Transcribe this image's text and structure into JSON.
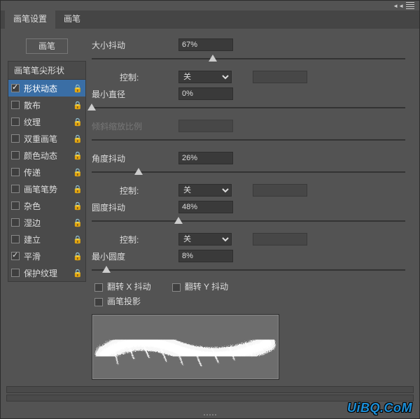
{
  "tabs": {
    "settings": "画笔设置",
    "brush": "画笔"
  },
  "brushBtn": "画笔",
  "listHeader": "画笔笔尖形状",
  "listItems": [
    {
      "label": "形状动态",
      "checked": true,
      "selected": true
    },
    {
      "label": "散布",
      "checked": false
    },
    {
      "label": "纹理",
      "checked": false
    },
    {
      "label": "双重画笔",
      "checked": false
    },
    {
      "label": "颜色动态",
      "checked": false
    },
    {
      "label": "传递",
      "checked": false
    },
    {
      "label": "画笔笔势",
      "checked": false
    },
    {
      "label": "杂色",
      "checked": false
    },
    {
      "label": "湿边",
      "checked": false
    },
    {
      "label": "建立",
      "checked": false
    },
    {
      "label": "平滑",
      "checked": true
    },
    {
      "label": "保护纹理",
      "checked": false
    }
  ],
  "controls": {
    "sizeJitter": {
      "label": "大小抖动",
      "value": "67%",
      "pct": 67
    },
    "control1": {
      "label": "控制:",
      "value": "关"
    },
    "minDiameter": {
      "label": "最小直径",
      "value": "0%",
      "pct": 0
    },
    "tiltScale": {
      "label": "倾斜缩放比例",
      "value": ""
    },
    "angleJitter": {
      "label": "角度抖动",
      "value": "26%",
      "pct": 26
    },
    "control2": {
      "label": "控制:",
      "value": "关"
    },
    "roundJitter": {
      "label": "圆度抖动",
      "value": "48%",
      "pct": 48
    },
    "control3": {
      "label": "控制:",
      "value": "关"
    },
    "minRound": {
      "label": "最小圆度",
      "value": "8%",
      "pct": 8
    },
    "flipX": "翻转 X 抖动",
    "flipY": "翻转 Y 抖动",
    "brushProj": "画笔投影"
  },
  "watermark": "UiBQ.CoM"
}
